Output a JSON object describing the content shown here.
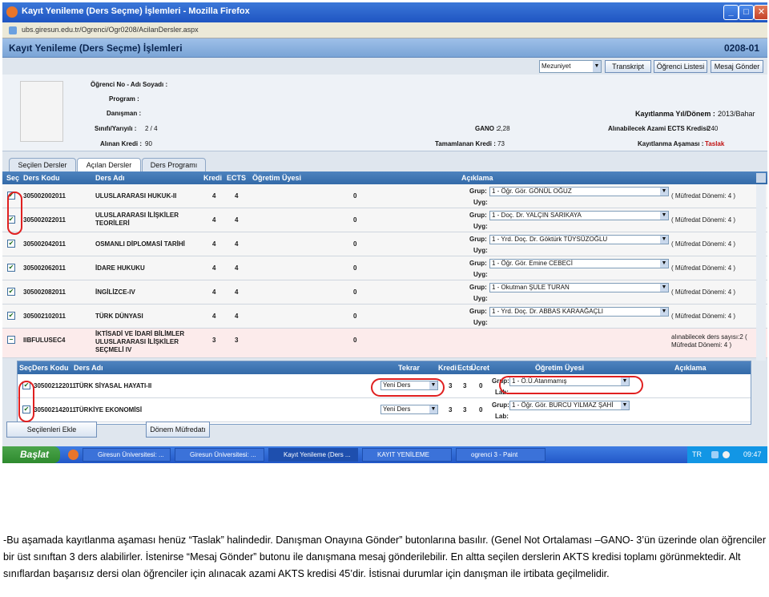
{
  "window": {
    "title": "Kayıt Yenileme (Ders Seçme) İşlemleri - Mozilla Firefox",
    "url": "ubs.giresun.edu.tr/Ogrenci/Ogr0208/AcilanDersler.aspx"
  },
  "page": {
    "title": "Kayıt Yenileme (Ders Seçme) İşlemleri",
    "code": "0208-01"
  },
  "toolbar": {
    "select": "Mezuniyet",
    "buttons": [
      "Transkript",
      "Öğrenci Listesi",
      "Mesaj Gönder"
    ]
  },
  "info": {
    "ogr_no_label": "Öğrenci No - Adı Soyadı :",
    "program_label": "Program :",
    "danisman_label": "Danışman :",
    "sinif_label": "Sınıfı/Yarıyılı :",
    "sinif_value": "2 / 4",
    "alinan_label": "Alınan Kredi :",
    "alinan_value": "90",
    "gano_label": "GANO :",
    "gano_value": "2,28",
    "tamamlanan_label": "Tamamlanan Kredi :",
    "tamamlanan_value": "73",
    "donem_label": "Kayıtlanma Yıl/Dönem :",
    "donem_value": "2013/Bahar",
    "ects_label": "Alınabilecek Azami ECTS Kredisi:",
    "ects_value": "240",
    "asama_label": "Kayıtlanma Aşaması :",
    "asama_value": "Taslak"
  },
  "tabs": [
    "Seçilen Dersler",
    "Açılan Dersler",
    "Ders Programı"
  ],
  "grid_headers": [
    "Seç",
    "Ders Kodu",
    "Ders Adı",
    "Kredi",
    "ECTS",
    "Öğretim Üyesi",
    "Açıklama"
  ],
  "grup_label": "Grup:",
  "uyg_label": "Uyg:",
  "rows": [
    {
      "code": "305002002011",
      "name": "ULUSLARARASI HUKUK-II",
      "kredi": "4",
      "ects": "4",
      "ogretim": "0",
      "grup": "1 - Öğr. Gör. GÖNÜL OĞUZ",
      "note": "( Müfredat Dönemi: 4 )",
      "checked": "✔"
    },
    {
      "code": "305002022011",
      "name": "ULUSLARARASI İLİŞKİLER TEORİLERİ",
      "kredi": "4",
      "ects": "4",
      "ogretim": "0",
      "grup": "1 - Doç. Dr. YALÇIN SARIKAYA",
      "note": "( Müfredat Dönemi: 4 )",
      "checked": "✔"
    },
    {
      "code": "305002042011",
      "name": "OSMANLI DİPLOMASİ TARİHİ",
      "kredi": "4",
      "ects": "4",
      "ogretim": "0",
      "grup": "1 - Yrd. Doç. Dr. Göktürk TÜYSÜZOĞLU",
      "note": "( Müfredat Dönemi: 4 )",
      "checked": "✔"
    },
    {
      "code": "305002062011",
      "name": "İDARE HUKUKU",
      "kredi": "4",
      "ects": "4",
      "ogretim": "0",
      "grup": "1 - Öğr. Gör. Emine CEBECİ",
      "note": "( Müfredat Dönemi: 4 )",
      "checked": "✔"
    },
    {
      "code": "305002082011",
      "name": "İNGİLİZCE-IV",
      "kredi": "4",
      "ects": "4",
      "ogretim": "0",
      "grup": "1 - Okutman ŞULE TURAN",
      "note": "( Müfredat Dönemi: 4 )",
      "checked": "✔"
    },
    {
      "code": "305002102011",
      "name": "TÜRK DÜNYASI",
      "kredi": "4",
      "ects": "4",
      "ogretim": "0",
      "grup": "1 - Yrd. Doç. Dr. ABBAS KARAAĞAÇLI",
      "note": "( Müfredat Dönemi: 4 )",
      "checked": "✔"
    },
    {
      "code": "IIBFULUSEC4",
      "name": "İKTİSADİ VE İDARİ BİLİMLER ULUSLARARASI İLİŞKİLER SEÇMELİ IV",
      "kredi": "3",
      "ects": "3",
      "ogretim": "0",
      "grup": "",
      "note": "alınabilecek ders sayısı:2 ( Müfredat Dönemi: 4 )",
      "checked": "−"
    }
  ],
  "sub_headers": [
    "Seç",
    "Ders Kodu",
    "Ders Adı",
    "Tekrar",
    "Kredi",
    "Ects",
    "Ücret",
    "Öğretim Üyesi",
    "Açıklama"
  ],
  "sub_rows": [
    {
      "code": "305002122011",
      "name": "TÜRK SİYASAL HAYATI-II",
      "tekrar": "Yeni Ders",
      "kredi": "3",
      "ects": "3",
      "ucret": "0",
      "grup": "1 - Ö.Ü.Atanmamış",
      "lab": "Lab:"
    },
    {
      "code": "305002142011",
      "name": "TÜRKİYE EKONOMİSİ",
      "tekrar": "Yeni Ders",
      "kredi": "3",
      "ects": "3",
      "ucret": "0",
      "grup": "1 - Öğr. Gör. BURCU YILMAZ ŞAHİ",
      "lab": "Lab:"
    }
  ],
  "bottom_buttons": [
    "Seçilenleri Ekle",
    "Dönem Müfredatı"
  ],
  "taskbar": {
    "start": "Başlat",
    "tasks": [
      "Giresun Üniversitesi: ...",
      "Giresun Üniversitesi: ...",
      "Kayıt Yenileme (Ders ...",
      "KAYIT YENİLEME",
      "ogrenci 3 - Paint"
    ],
    "lang": "TR",
    "time": "09:47"
  },
  "caption": "-Bu aşamada kayıtlanma aşaması henüz “Taslak” halindedir. Danışman Onayına Gönder” butonlarına basılır. (Genel Not Ortalaması –GANO- 3’ün üzerinde olan öğrenciler bir üst sınıftan 3 ders alabilirler. İstenirse “Mesaj Gönder” butonu ile danışmana mesaj gönderilebilir. En altta seçilen derslerin AKTS kredisi toplamı görünmektedir. Alt sınıflardan başarısız dersi olan öğrenciler için alınacak azami AKTS kredisi 45’dir. İstisnai durumlar için danışman ile irtibata geçilmelidir.",
  "colors": {
    "titlebar": "#2a63cf",
    "grid_header": "#3f74b3",
    "annotation": "#e02020",
    "taskbar": "#2f6ad6"
  }
}
